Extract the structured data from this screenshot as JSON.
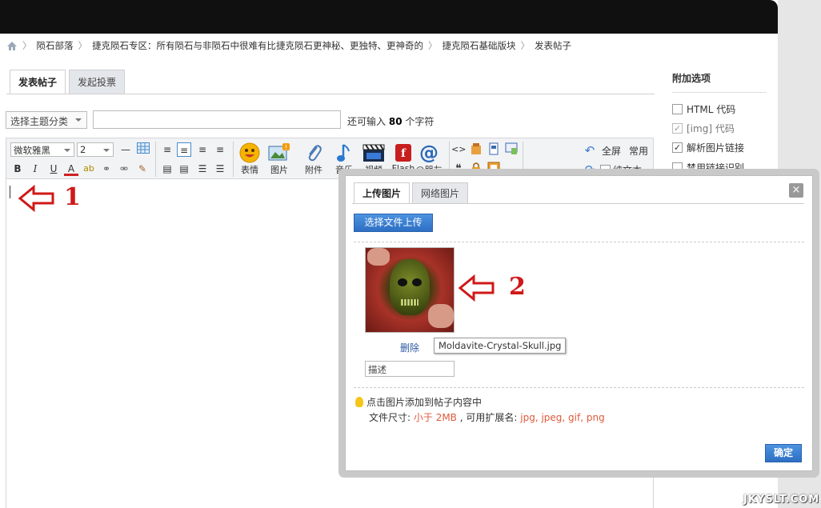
{
  "breadcrumb": {
    "items": [
      "陨石部落",
      "捷克陨石专区：所有陨石与非陨石中很难有比捷克陨石更神秘、更独特、更神奇的",
      "捷克陨石基础版块",
      "发表帖子"
    ]
  },
  "tabs": [
    "发表帖子",
    "发起投票"
  ],
  "subject": {
    "category_label": "选择主题分类",
    "counter_prefix": "还可输入",
    "counter_value": "80",
    "counter_suffix": "个字符"
  },
  "toolbar": {
    "font": "微软雅黑",
    "size": "2",
    "buttons": [
      "表情",
      "图片",
      "附件",
      "音乐",
      "视频",
      "Flash",
      "@朋友"
    ],
    "fullscreen": "全屏",
    "common": "常用",
    "plaintext": "纯文本"
  },
  "sidebar": {
    "title": "附加选项",
    "options": [
      {
        "label": "HTML 代码",
        "checked": false
      },
      {
        "label": "[img] 代码",
        "checked": true
      },
      {
        "label": "解析图片链接",
        "checked": true
      },
      {
        "label": "禁用链接识别",
        "checked": false
      }
    ]
  },
  "dialog": {
    "tabs": [
      "上传图片",
      "网络图片"
    ],
    "close": "×",
    "upload_button": "选择文件上传",
    "delete_label": "删除",
    "filename": "Moldavite-Crystal-Skull.jpg",
    "description_placeholder": "描述",
    "hint1": "点击图片添加到帖子内容中",
    "hint2_prefix": "文件尺寸:",
    "hint2_size": "小于 2MB",
    "hint2_mid": ", 可用扩展名:",
    "hint2_exts": "jpg, jpeg, gif, png",
    "ok": "确定"
  },
  "annotations": [
    "1",
    "2"
  ],
  "watermark": "JKYSLT.COM",
  "colors": {
    "accent_blue": "#2d6fc4",
    "annotation_red": "#d01818",
    "hint_red": "#e05a3c"
  }
}
